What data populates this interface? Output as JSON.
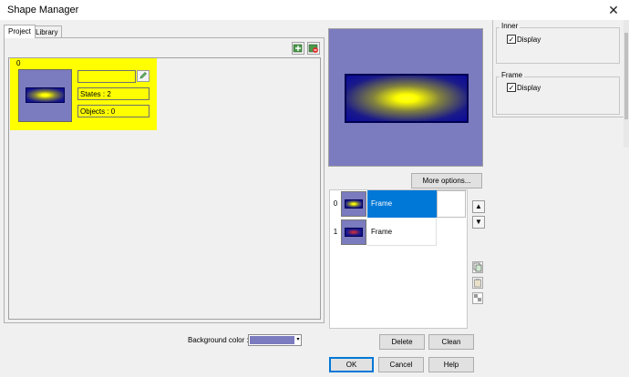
{
  "window": {
    "title": "Shape Manager",
    "close_glyph": "✕"
  },
  "tabs": [
    {
      "label": "Project",
      "active": true
    },
    {
      "label": "Library",
      "active": false
    }
  ],
  "toolbar": {
    "icons": [
      "add-shape-icon",
      "delete-shape-icon"
    ]
  },
  "shape_card": {
    "index": "0",
    "name_value": "",
    "states": "States : 2",
    "objects": "Objects : 0",
    "highlight_color": "#ffff00"
  },
  "preview": {
    "background_color": "#7b7bbf"
  },
  "more_options_label": "More options...",
  "states_list": [
    {
      "index": "0",
      "label": "Frame",
      "selected": true
    },
    {
      "index": "1",
      "label": "Frame",
      "selected": false
    }
  ],
  "arrows": {
    "up": "▲",
    "down": "▼"
  },
  "side_icons": [
    "copy-state-icon",
    "paste-state-icon",
    "transparency-icon"
  ],
  "buttons": {
    "delete": "Delete",
    "clean": "Clean",
    "ok": "OK",
    "cancel": "Cancel",
    "help": "Help"
  },
  "background_color": {
    "label": "Background color :",
    "value": "#7b7bbf"
  },
  "properties": {
    "inner": {
      "title": "Inner",
      "display_label": "Display",
      "checked": true
    },
    "frame": {
      "title": "Frame",
      "display_label": "Display",
      "checked": true
    }
  }
}
